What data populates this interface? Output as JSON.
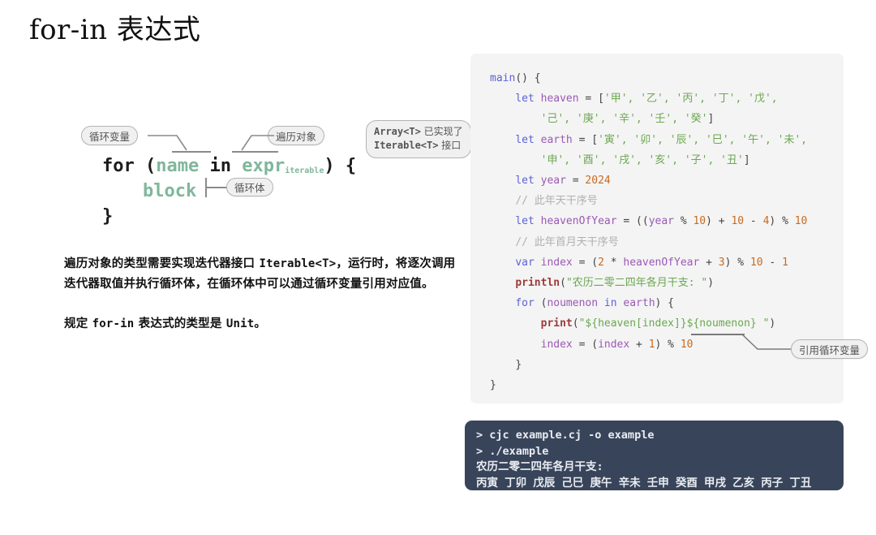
{
  "slide": {
    "title": "for-in 表达式"
  },
  "syntax_diagram": {
    "labels": {
      "loop_variable": "循环变量",
      "iterable_object": "遍历对象",
      "loop_body": "循环体"
    },
    "line1_for": "for (",
    "line1_name": "name",
    "line1_in": " in ",
    "line1_expr": "expr",
    "line1_expr_sub": "iterable",
    "line1_tail": ") {",
    "line2_block": "block",
    "line3_close": "}"
  },
  "callout": {
    "line1_code": "Array<T>",
    "line1_text": " 已实现了",
    "line2_code": "Iterable<T>",
    "line2_text": " 接口"
  },
  "body": {
    "paragraph1_a": "遍历对象的类型需要实现迭代器接口 ",
    "paragraph1_code": "Iterable<T>",
    "paragraph1_b": "，运行时，将逐次调用迭代器取值并执行循环体，在循环体中可以通过循环变量引用对应值。",
    "paragraph2_a": "规定 ",
    "paragraph2_code1": "for-in",
    "paragraph2_b": " 表达式的类型是 ",
    "paragraph2_code2": "Unit",
    "paragraph2_c": "。"
  },
  "code": {
    "language": "cangjie",
    "lines": [
      {
        "indent": 0,
        "tokens": [
          {
            "t": "main",
            "c": "main"
          },
          {
            "t": "() {",
            "c": "plain"
          }
        ]
      },
      {
        "indent": 1,
        "tokens": [
          {
            "t": "let ",
            "c": "kw"
          },
          {
            "t": "heaven",
            "c": "ident"
          },
          {
            "t": " = [",
            "c": "plain"
          },
          {
            "t": "'甲', '乙', '丙', '丁', '戊',",
            "c": "str"
          }
        ]
      },
      {
        "indent": 2,
        "tokens": [
          {
            "t": "'己', '庚', '辛', '壬', '癸'",
            "c": "str"
          },
          {
            "t": "]",
            "c": "plain"
          }
        ]
      },
      {
        "indent": 1,
        "tokens": [
          {
            "t": "let ",
            "c": "kw"
          },
          {
            "t": "earth",
            "c": "ident"
          },
          {
            "t": " = [",
            "c": "plain"
          },
          {
            "t": "'寅', '卯', '辰', '巳', '午', '未',",
            "c": "str"
          }
        ]
      },
      {
        "indent": 2,
        "tokens": [
          {
            "t": "'申', '酉', '戌', '亥', '子', '丑'",
            "c": "str"
          },
          {
            "t": "]",
            "c": "plain"
          }
        ]
      },
      {
        "indent": 1,
        "tokens": [
          {
            "t": "let ",
            "c": "kw"
          },
          {
            "t": "year",
            "c": "ident"
          },
          {
            "t": " = ",
            "c": "plain"
          },
          {
            "t": "2024",
            "c": "num"
          }
        ]
      },
      {
        "indent": 1,
        "tokens": [
          {
            "t": "// 此年天干序号",
            "c": "cmt"
          }
        ]
      },
      {
        "indent": 1,
        "tokens": [
          {
            "t": "let ",
            "c": "kw"
          },
          {
            "t": "heavenOfYear",
            "c": "ident"
          },
          {
            "t": " = ((",
            "c": "plain"
          },
          {
            "t": "year",
            "c": "ident"
          },
          {
            "t": " % ",
            "c": "plain"
          },
          {
            "t": "10",
            "c": "num"
          },
          {
            "t": ") + ",
            "c": "plain"
          },
          {
            "t": "10",
            "c": "num"
          },
          {
            "t": " - ",
            "c": "plain"
          },
          {
            "t": "4",
            "c": "num"
          },
          {
            "t": ") % ",
            "c": "plain"
          },
          {
            "t": "10",
            "c": "num"
          }
        ]
      },
      {
        "indent": 1,
        "tokens": [
          {
            "t": "// 此年首月天干序号",
            "c": "cmt"
          }
        ]
      },
      {
        "indent": 1,
        "tokens": [
          {
            "t": "var ",
            "c": "kw"
          },
          {
            "t": "index",
            "c": "ident"
          },
          {
            "t": " = (",
            "c": "plain"
          },
          {
            "t": "2",
            "c": "num"
          },
          {
            "t": " * ",
            "c": "plain"
          },
          {
            "t": "heavenOfYear",
            "c": "ident"
          },
          {
            "t": " + ",
            "c": "plain"
          },
          {
            "t": "3",
            "c": "num"
          },
          {
            "t": ") % ",
            "c": "plain"
          },
          {
            "t": "10",
            "c": "num"
          },
          {
            "t": " - ",
            "c": "plain"
          },
          {
            "t": "1",
            "c": "num"
          }
        ]
      },
      {
        "indent": 1,
        "tokens": [
          {
            "t": "println",
            "c": "fn"
          },
          {
            "t": "(",
            "c": "plain"
          },
          {
            "t": "\"农历二零二四年各月干支: \"",
            "c": "str"
          },
          {
            "t": ")",
            "c": "plain"
          }
        ]
      },
      {
        "indent": 1,
        "tokens": [
          {
            "t": "for ",
            "c": "kw"
          },
          {
            "t": "(",
            "c": "plain"
          },
          {
            "t": "noumenon",
            "c": "ident"
          },
          {
            "t": " in ",
            "c": "kw"
          },
          {
            "t": "earth",
            "c": "ident"
          },
          {
            "t": ") {",
            "c": "plain"
          }
        ]
      },
      {
        "indent": 2,
        "tokens": [
          {
            "t": "print",
            "c": "fn"
          },
          {
            "t": "(",
            "c": "plain"
          },
          {
            "t": "\"${heaven[index]}${noumenon} \"",
            "c": "str"
          },
          {
            "t": ")",
            "c": "plain"
          }
        ]
      },
      {
        "indent": 2,
        "tokens": [
          {
            "t": "index",
            "c": "ident"
          },
          {
            "t": " = (",
            "c": "plain"
          },
          {
            "t": "index",
            "c": "ident"
          },
          {
            "t": " + ",
            "c": "plain"
          },
          {
            "t": "1",
            "c": "num"
          },
          {
            "t": ") % ",
            "c": "plain"
          },
          {
            "t": "10",
            "c": "num"
          }
        ]
      },
      {
        "indent": 1,
        "tokens": [
          {
            "t": "}",
            "c": "plain"
          }
        ]
      },
      {
        "indent": 0,
        "tokens": [
          {
            "t": "}",
            "c": "plain"
          }
        ]
      }
    ]
  },
  "code_annotation": {
    "label": "引用循环变量"
  },
  "terminal": {
    "command1": "> cjc example.cj -o example",
    "command2": "> ./example",
    "output1": "农历二零二四年各月干支:",
    "output2": "丙寅 丁卯 戊辰 己巳 庚午 辛未 壬申 癸酉 甲戌 乙亥 丙子 丁丑"
  },
  "colors": {
    "accent_green": "#7fb79b",
    "code_bg": "#f4f4f4",
    "terminal_bg": "#384459",
    "pill_border": "#b4b4b4",
    "pill_fill": "#f0f0f0"
  }
}
